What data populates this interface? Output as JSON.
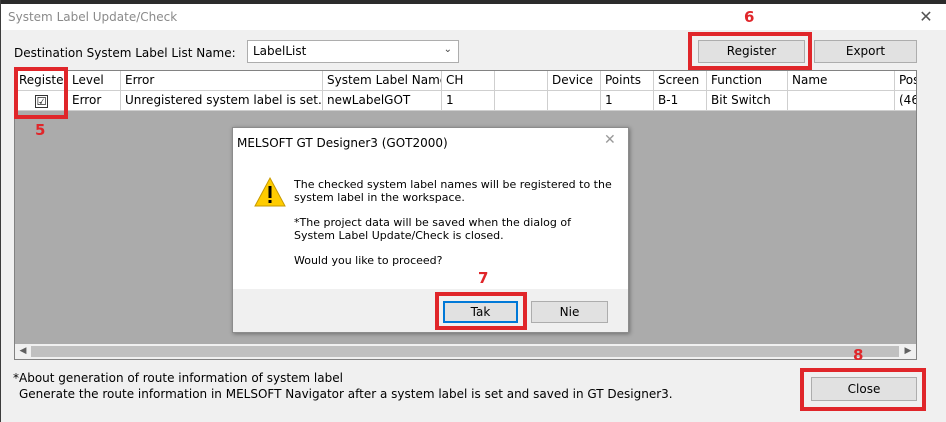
{
  "window": {
    "title": "System Label Update/Check",
    "close_glyph": "✕"
  },
  "toolbar": {
    "dest_label": "Destination System Label List Name:",
    "dest_value": "LabelList",
    "register_label": "Register",
    "export_label": "Export"
  },
  "table": {
    "columns": [
      "Register",
      "Level",
      "Error",
      "System Label Name",
      "CH",
      "",
      "Device",
      "Points",
      "Screen",
      "Function",
      "Name",
      "Pos"
    ],
    "rows": [
      {
        "checked": "☑",
        "level": "Error",
        "error": "Unregistered system label is set. Re",
        "label": "newLabelGOT",
        "ch": "1",
        "blank": "",
        "device": "",
        "points": "1",
        "screen": "B-1",
        "function": "Bit Switch",
        "name": "",
        "pos": "(46"
      }
    ]
  },
  "notes": {
    "line1": "*About generation of route information of system label",
    "line2": "Generate the route information in MELSOFT Navigator after a system label is set and saved in GT Designer3."
  },
  "close_button": "Close",
  "dialog": {
    "title": "MELSOFT GT Designer3 (GOT2000)",
    "message1": "The checked system label names will be registered to the system label in the workspace.",
    "message2": "*The project data will be saved when the dialog of System Label Update/Check is closed.",
    "message3": "Would you like to proceed?",
    "yes_label": "Tak",
    "no_label": "Nie",
    "icon": "warning-icon"
  },
  "annotations": {
    "n5": "5",
    "n6": "6",
    "n7": "7",
    "n8": "8"
  },
  "colors": {
    "annotation": "#e0262a",
    "grid_bg": "#ababab",
    "focus": "#0078d7"
  }
}
